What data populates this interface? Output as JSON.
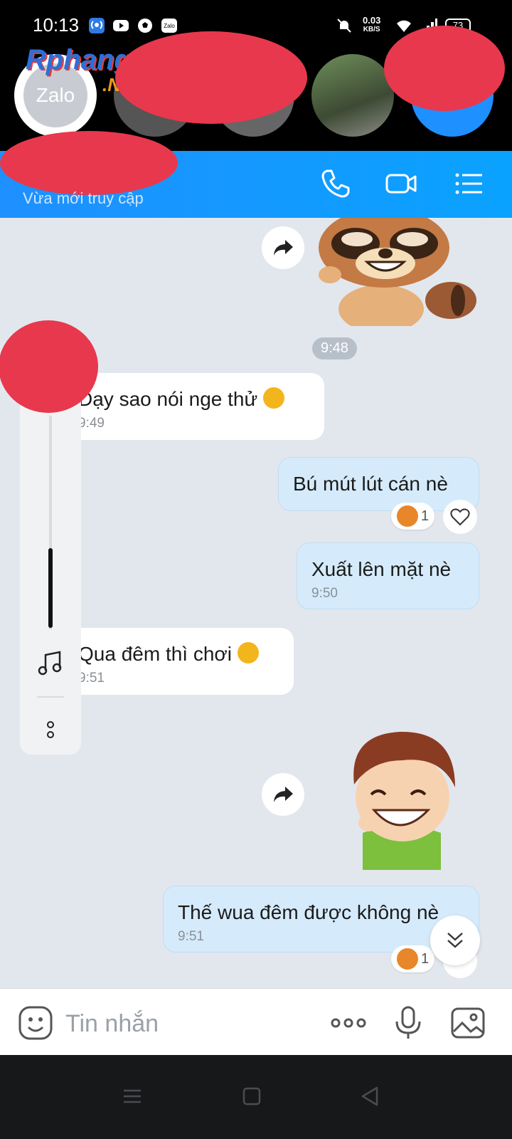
{
  "status_bar": {
    "time": "10:13",
    "net_speed_value": "0.03",
    "net_speed_unit": "KB/S",
    "battery": "73"
  },
  "bubbles": {
    "app_label": "Zalo",
    "watermark_main": "Rphangs",
    "watermark_sub": ".NET"
  },
  "header": {
    "contact_status": "Vừa mới truy cập"
  },
  "chat": {
    "time_divider": "9:48",
    "messages": [
      {
        "text": "Dạy sao nói nge thử",
        "time": "9:49"
      },
      {
        "text": "Bú mút lút cán nè"
      },
      {
        "text": "Xuất lên mặt nè",
        "time": "9:50"
      },
      {
        "text": "Qua đêm thì chơi",
        "time": "9:51"
      },
      {
        "text": "Thế wua đêm được không nè",
        "time": "9:51"
      }
    ],
    "reaction_count_1": "1",
    "reaction_count_2": "1"
  },
  "composer": {
    "placeholder": "Tin nhắn"
  },
  "colors": {
    "header_blue": "#1e90ff",
    "outgoing_bubble": "#d5ebfb",
    "incoming_bubble": "#ffffff",
    "chat_background": "#e2e7ee"
  }
}
